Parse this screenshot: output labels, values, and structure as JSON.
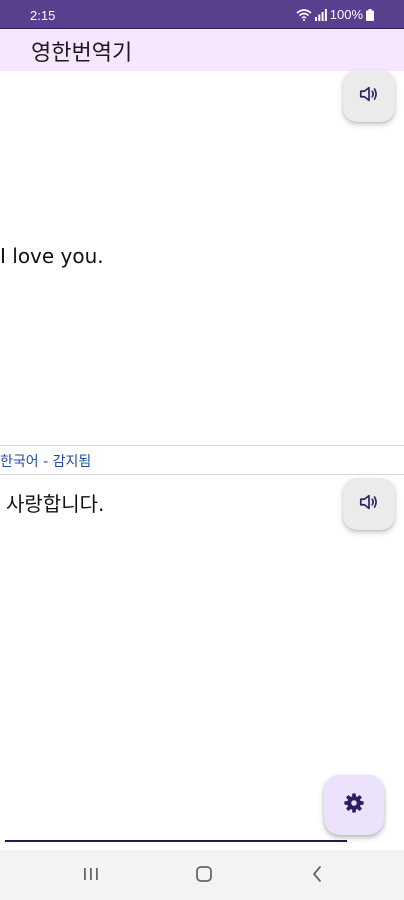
{
  "status_bar": {
    "time": "2:15",
    "battery": "100%",
    "icons": [
      "wifi-icon",
      "signal-icon",
      "battery-icon"
    ]
  },
  "app_bar": {
    "title": "영한번역기"
  },
  "source": {
    "text": "I love you.",
    "speak_icon": "speaker-icon"
  },
  "result": {
    "detected_label": "한국어 - 감지됨",
    "text": "사랑합니다.",
    "speak_icon": "speaker-icon"
  },
  "settings_button": {
    "icon": "gear-icon"
  },
  "nav_bar": {
    "icons": [
      "recent-apps-icon",
      "home-icon",
      "back-icon"
    ]
  },
  "colors": {
    "status_bar": "#5b3f8f",
    "app_bar": "#f8e6ff",
    "detected_label": "#1f4d99",
    "settings_fab": "#ece2fb",
    "icon": "#2b2060"
  }
}
